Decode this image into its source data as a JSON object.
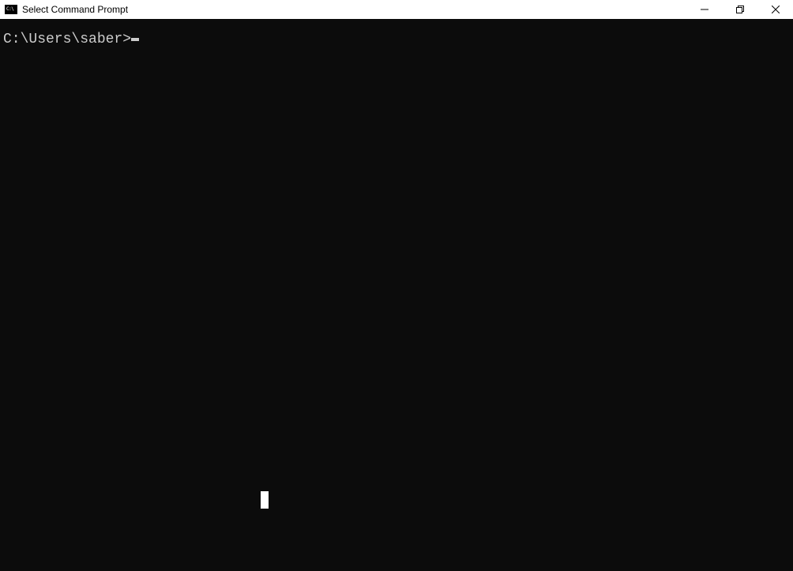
{
  "window": {
    "title": "Select Command Prompt",
    "icon_text": "C:\\"
  },
  "terminal": {
    "prompt": "C:\\Users\\saber>"
  }
}
